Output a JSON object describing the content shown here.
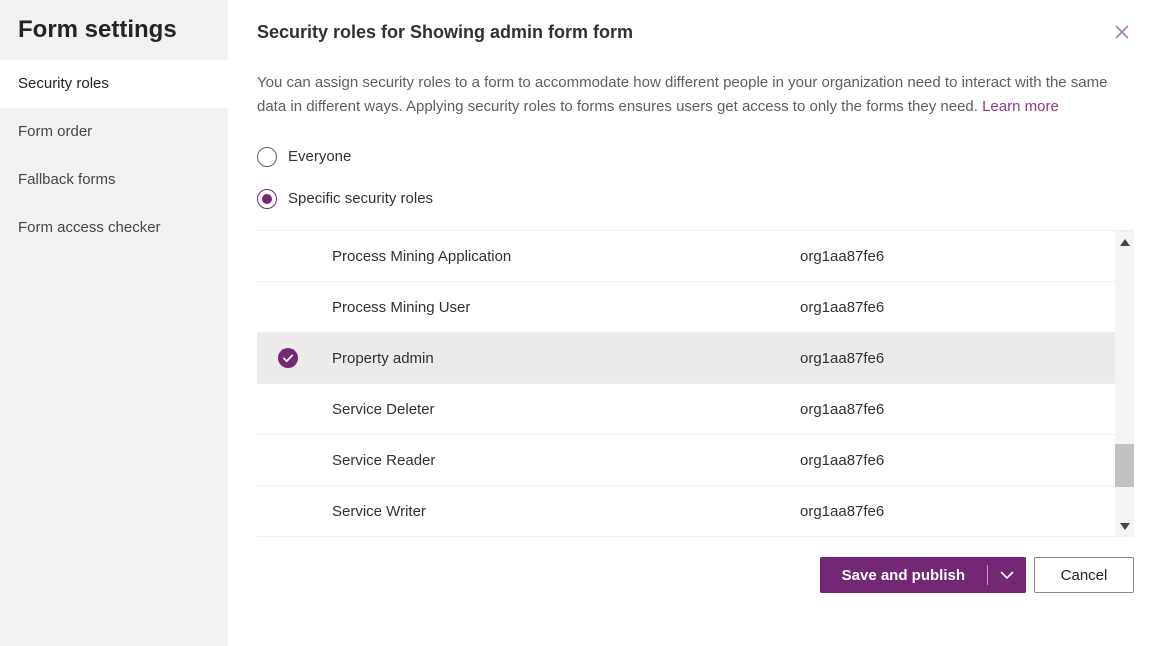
{
  "sidebar": {
    "title": "Form settings",
    "items": [
      {
        "label": "Security roles",
        "selected": true
      },
      {
        "label": "Form order",
        "selected": false
      },
      {
        "label": "Fallback forms",
        "selected": false
      },
      {
        "label": "Form access checker",
        "selected": false
      }
    ]
  },
  "dialog": {
    "title": "Security roles for Showing admin form form",
    "description": "You can assign security roles to a form to accommodate how different people in your organization need to interact with the same data in different ways. Applying security roles to forms ensures users get access to only the forms they need.",
    "learn_more_label": "Learn more",
    "radio_options": [
      {
        "label": "Everyone",
        "selected": false
      },
      {
        "label": "Specific security roles",
        "selected": true
      }
    ],
    "roles_table": {
      "rows": [
        {
          "name": "Process Mining Application",
          "org": "org1aa87fe6",
          "checked": false
        },
        {
          "name": "Process Mining User",
          "org": "org1aa87fe6",
          "checked": false
        },
        {
          "name": "Property admin",
          "org": "org1aa87fe6",
          "checked": true
        },
        {
          "name": "Service Deleter",
          "org": "org1aa87fe6",
          "checked": false
        },
        {
          "name": "Service Reader",
          "org": "org1aa87fe6",
          "checked": false
        },
        {
          "name": "Service Writer",
          "org": "org1aa87fe6",
          "checked": false
        }
      ]
    },
    "footer": {
      "save_label": "Save and publish",
      "cancel_label": "Cancel"
    }
  },
  "icons": {
    "close": "close-x",
    "check": "checkmark-circle",
    "chevron_down": "chevron-down",
    "scroll_up": "triangle-up",
    "scroll_down": "triangle-down"
  },
  "colors": {
    "accent": "#742774",
    "link": "#8b3d8b",
    "close_icon": "#a77fb4",
    "sidebar_bg": "#f3f2f1",
    "selected_row_bg": "#edebe9",
    "row_border": "#f1efed",
    "body_text": "#323130",
    "muted_text": "#605e5c"
  }
}
